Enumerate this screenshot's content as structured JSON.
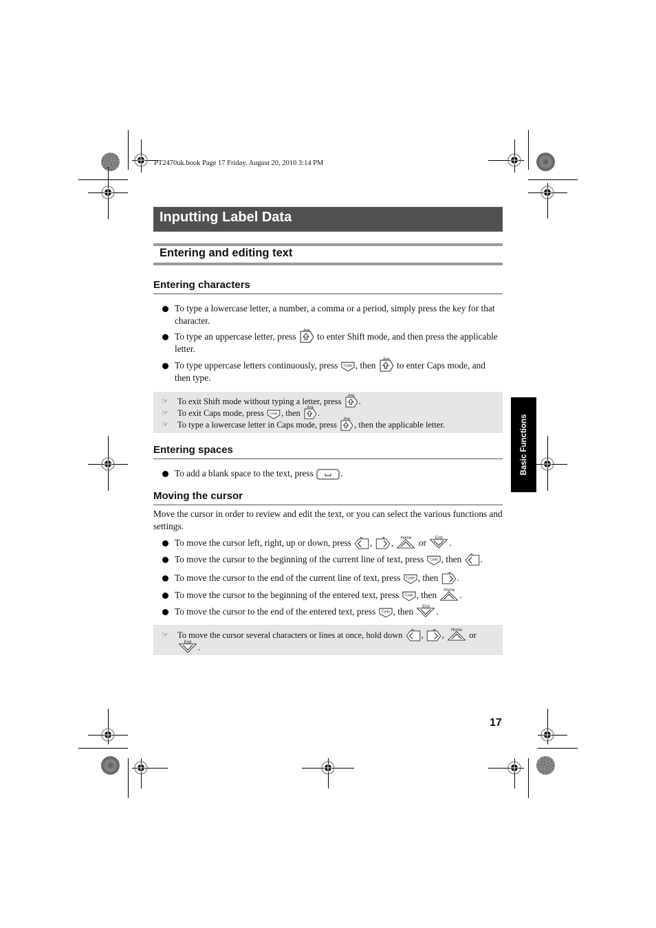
{
  "print_header": "PT2470uk.book  Page 17  Friday, August 20, 2010  3:14 PM",
  "chapter_title": "Inputting Label Data",
  "section_title": "Entering and editing text",
  "side_tab": "Basic Functions",
  "page_number": "17",
  "key_captions": {
    "shift": "A•a",
    "code": "Code",
    "home": "Home",
    "end": "End"
  },
  "entering_characters": {
    "heading": "Entering characters",
    "bullets": [
      {
        "text": "To type a lowercase letter, a number, a comma or a period, simply press the key for that character."
      },
      {
        "before": "To type an uppercase letter, press",
        "after": "to enter Shift mode, and then press the applicable letter.",
        "keys": [
          "shift-key"
        ]
      },
      {
        "before": "To type uppercase letters continuously, press",
        "mid": ", then",
        "after": "to enter Caps mode, and then type.",
        "keys": [
          "code-key",
          "shift-key"
        ]
      }
    ],
    "notes": [
      {
        "before": "To exit Shift mode without typing a letter, press",
        "after": "."
      },
      {
        "before": "To exit Caps mode, press",
        "mid": ", then",
        "after": "."
      },
      {
        "before": "To type a lowercase letter in Caps mode, press",
        "after": ", then the applicable letter."
      }
    ]
  },
  "entering_spaces": {
    "heading": "Entering spaces",
    "bullet": {
      "before": "To add a blank space to the text, press",
      "after": "."
    }
  },
  "moving_cursor": {
    "heading": "Moving the cursor",
    "intro": "Move the cursor in order to review and edit the text, or you can select the various functions and settings.",
    "bullets": [
      {
        "before": "To move the cursor left, right, up or down, press",
        "sep": ",",
        "or": "or",
        "after": "."
      },
      {
        "before": "To move the cursor to the beginning of the current line of text, press",
        "mid": ", then",
        "after": "."
      },
      {
        "before": "To move the cursor to the end of the current line of text, press",
        "mid": ", then",
        "after": "."
      },
      {
        "before": "To move the cursor to the beginning of the entered text, press",
        "mid": ", then",
        "after": "."
      },
      {
        "before": "To move the cursor to the end of the entered text, press",
        "mid": ", then",
        "after": "."
      }
    ],
    "note": {
      "before": "To move the cursor several characters or lines at once, hold down",
      "sep": ",",
      "or": "or",
      "after": "."
    }
  },
  "note_symbol": "☞"
}
